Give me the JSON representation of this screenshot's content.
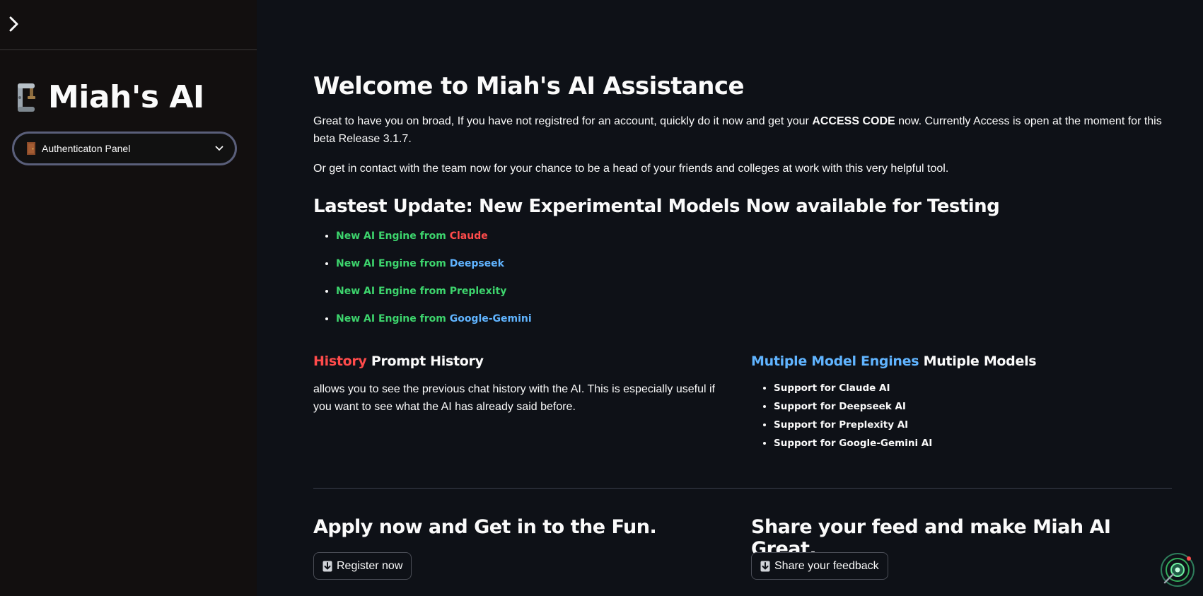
{
  "sidebar": {
    "brand_title": "Miah's AI",
    "select_value": "Authenticaton Panel"
  },
  "main": {
    "title": "Welcome to Miah's AI Assistance",
    "intro": {
      "part1": "Great to have you on broad, If you have not registred for an account, quickly do it now and get your ",
      "bold": "ACCESS CODE",
      "part2": " now. Currently Access is open at the moment for this beta Release 3.1.7."
    },
    "contact_text": "Or get in contact with the team now for your chance to be a head of your friends and colleges at work with this very helpful tool.",
    "update_heading": "Lastest Update: New Experimental Models Now available for Testing",
    "engines": [
      {
        "prefix": "New AI Engine from ",
        "name": "Claude",
        "color": "red"
      },
      {
        "prefix": "New AI Engine from ",
        "name": "Deepseek",
        "color": "blue"
      },
      {
        "prefix": "New AI Engine from ",
        "name": "Preplexity",
        "color": "green"
      },
      {
        "prefix": "New AI Engine from ",
        "name": "Google-Gemini",
        "color": "blue"
      }
    ],
    "history": {
      "accent": "History",
      "title": " Prompt History",
      "text": "allows you to see the previous chat history with the AI. This is especially useful if you want to see what the AI has already said before."
    },
    "models": {
      "accent": "Mutiple Model Engines",
      "title": " Mutiple Models",
      "items": [
        "Support for Claude AI",
        "Support for Deepseek AI",
        "Support for Preplexity AI",
        "Support for Google-Gemini AI"
      ]
    },
    "apply_heading": "Apply now and Get in to the Fun.",
    "register_button": "Register now",
    "share_heading": "Share your feed and make Miah AI Great.",
    "feedback_button": "Share your feedback"
  },
  "colors": {
    "background": "#0e1117",
    "sidebar": "#120f0f",
    "green": "#3dd56d",
    "red": "#ff4b4b",
    "blue": "#60b4ff"
  },
  "icons": {
    "collapse": "chevron-right-icon",
    "brand": "clamp-icon",
    "select_prefix": "door-icon",
    "select_caret": "chevron-down-icon",
    "button_prefix": "down-arrow-icon",
    "fab": "streamlit-status-icon"
  }
}
